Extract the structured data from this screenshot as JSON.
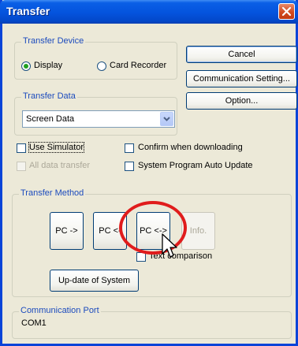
{
  "window": {
    "title": "Transfer"
  },
  "transfer_device": {
    "label": "Transfer Device",
    "options": [
      "Display",
      "Card Recorder"
    ],
    "selected": "Display"
  },
  "buttons": {
    "cancel": "Cancel",
    "communication_setting": "Communication Setting...",
    "option": "Option..."
  },
  "transfer_data": {
    "label": "Transfer Data",
    "selected_value": "Screen Data"
  },
  "checkboxes": {
    "use_simulator": "Use Simulator",
    "confirm_when_downloading": "Confirm when downloading",
    "all_data_transfer": "All data transfer",
    "system_program_auto_update": "System Program Auto Update",
    "text_comparison": "Text comparison"
  },
  "transfer_method": {
    "label": "Transfer Method",
    "pc_send": "PC ->",
    "pc_receive": "PC <-",
    "pc_compare": "PC <->",
    "info": "Info.",
    "update_system": "Up-date of System"
  },
  "communication_port": {
    "label": "Communication Port",
    "value": "COM1"
  },
  "colors": {
    "titlebar": "#0453dd",
    "group_label": "#1c4bbd",
    "highlight_circle": "#e01c1c",
    "selected_radio": "#21a121"
  },
  "icons": [
    "close-icon",
    "dropdown-arrow-icon",
    "mouse-cursor-icon",
    "check-icon"
  ]
}
